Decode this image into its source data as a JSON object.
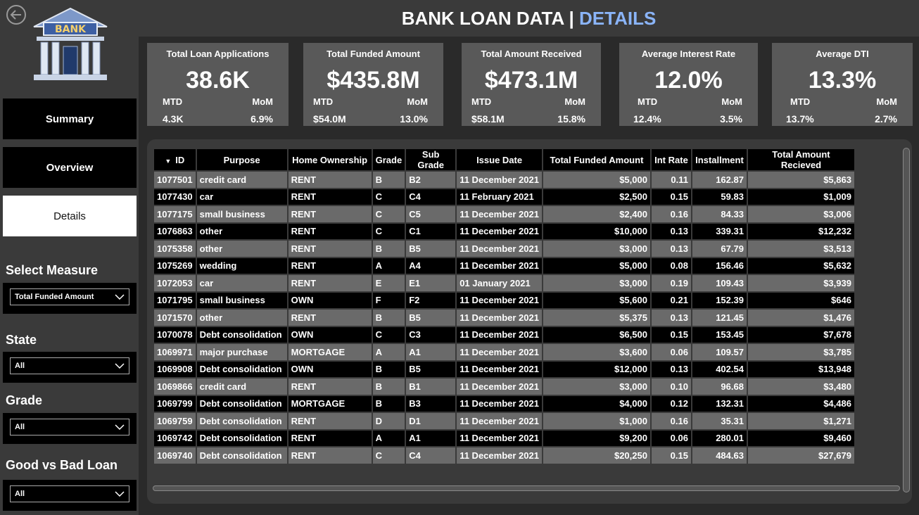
{
  "header": {
    "title": "BANK LOAN DATA | ",
    "title_accent": "DETAILS"
  },
  "logo": {
    "text": "BANK"
  },
  "nav": [
    {
      "label": "Summary",
      "active": false
    },
    {
      "label": "Overview",
      "active": false
    },
    {
      "label": "Details",
      "active": true
    }
  ],
  "filters": {
    "measure": {
      "title": "Select Measure",
      "value": "Total Funded Amount"
    },
    "state": {
      "title": "State",
      "value": "All"
    },
    "grade": {
      "title": "Grade",
      "value": "All"
    },
    "good_bad": {
      "title": "Good vs Bad Loan",
      "value": "All"
    }
  },
  "kpis": [
    {
      "title": "Total Loan Applications",
      "value": "38.6K",
      "mtd_label": "MTD",
      "mom_label": "MoM",
      "mtd": "4.3K",
      "mom": "6.9%"
    },
    {
      "title": "Total Funded Amount",
      "value": "$435.8M",
      "mtd_label": "MTD",
      "mom_label": "MoM",
      "mtd": "$54.0M",
      "mom": "13.0%"
    },
    {
      "title": "Total  Amount Received",
      "value": "$473.1M",
      "mtd_label": "MTD",
      "mom_label": "MoM",
      "mtd": "$58.1M",
      "mom": "15.8%"
    },
    {
      "title": "Average Interest Rate",
      "value": "12.0%",
      "mtd_label": "MTD",
      "mom_label": "MoM",
      "mtd": "12.4%",
      "mom": "3.5%"
    },
    {
      "title": "Average DTI",
      "value": "13.3%",
      "mtd_label": "MTD",
      "mom_label": "MoM",
      "mtd": "13.7%",
      "mom": "2.7%"
    }
  ],
  "table": {
    "columns": [
      "ID",
      "Purpose",
      "Home Ownership",
      "Grade",
      "Sub Grade",
      "Issue Date",
      "Total Funded Amount",
      "Int Rate",
      "Installment",
      "Total Amount Recieved"
    ],
    "rows": [
      [
        "1077501",
        "credit card",
        "RENT",
        "B",
        "B2",
        "11 December 2021",
        "$5,000",
        "0.11",
        "162.87",
        "$5,863"
      ],
      [
        "1077430",
        "car",
        "RENT",
        "C",
        "C4",
        "11 February 2021",
        "$2,500",
        "0.15",
        "59.83",
        "$1,009"
      ],
      [
        "1077175",
        "small business",
        "RENT",
        "C",
        "C5",
        "11 December 2021",
        "$2,400",
        "0.16",
        "84.33",
        "$3,006"
      ],
      [
        "1076863",
        "other",
        "RENT",
        "C",
        "C1",
        "11 December 2021",
        "$10,000",
        "0.13",
        "339.31",
        "$12,232"
      ],
      [
        "1075358",
        "other",
        "RENT",
        "B",
        "B5",
        "11 December 2021",
        "$3,000",
        "0.13",
        "67.79",
        "$3,513"
      ],
      [
        "1075269",
        "wedding",
        "RENT",
        "A",
        "A4",
        "11 December 2021",
        "$5,000",
        "0.08",
        "156.46",
        "$5,632"
      ],
      [
        "1072053",
        "car",
        "RENT",
        "E",
        "E1",
        "01 January 2021",
        "$3,000",
        "0.19",
        "109.43",
        "$3,939"
      ],
      [
        "1071795",
        "small business",
        "OWN",
        "F",
        "F2",
        "11 December 2021",
        "$5,600",
        "0.21",
        "152.39",
        "$646"
      ],
      [
        "1071570",
        "other",
        "RENT",
        "B",
        "B5",
        "11 December 2021",
        "$5,375",
        "0.13",
        "121.45",
        "$1,476"
      ],
      [
        "1070078",
        "Debt consolidation",
        "OWN",
        "C",
        "C3",
        "11 December 2021",
        "$6,500",
        "0.15",
        "153.45",
        "$7,678"
      ],
      [
        "1069971",
        "major purchase",
        "MORTGAGE",
        "A",
        "A1",
        "11 December 2021",
        "$3,600",
        "0.06",
        "109.57",
        "$3,785"
      ],
      [
        "1069908",
        "Debt consolidation",
        "OWN",
        "B",
        "B5",
        "11 December 2021",
        "$12,000",
        "0.13",
        "402.54",
        "$13,948"
      ],
      [
        "1069866",
        "credit card",
        "RENT",
        "B",
        "B1",
        "11 December 2021",
        "$3,000",
        "0.10",
        "96.68",
        "$3,480"
      ],
      [
        "1069799",
        "Debt consolidation",
        "MORTGAGE",
        "B",
        "B3",
        "11 December 2021",
        "$4,000",
        "0.12",
        "132.31",
        "$4,486"
      ],
      [
        "1069759",
        "Debt consolidation",
        "RENT",
        "D",
        "D1",
        "11 December 2021",
        "$1,000",
        "0.16",
        "35.31",
        "$1,271"
      ],
      [
        "1069742",
        "Debt consolidation",
        "RENT",
        "A",
        "A1",
        "11 December 2021",
        "$9,200",
        "0.06",
        "280.01",
        "$9,460"
      ],
      [
        "1069740",
        "Debt consolidation",
        "RENT",
        "C",
        "C4",
        "11 December 2021",
        "$20,250",
        "0.15",
        "484.63",
        "$27,679"
      ]
    ]
  }
}
